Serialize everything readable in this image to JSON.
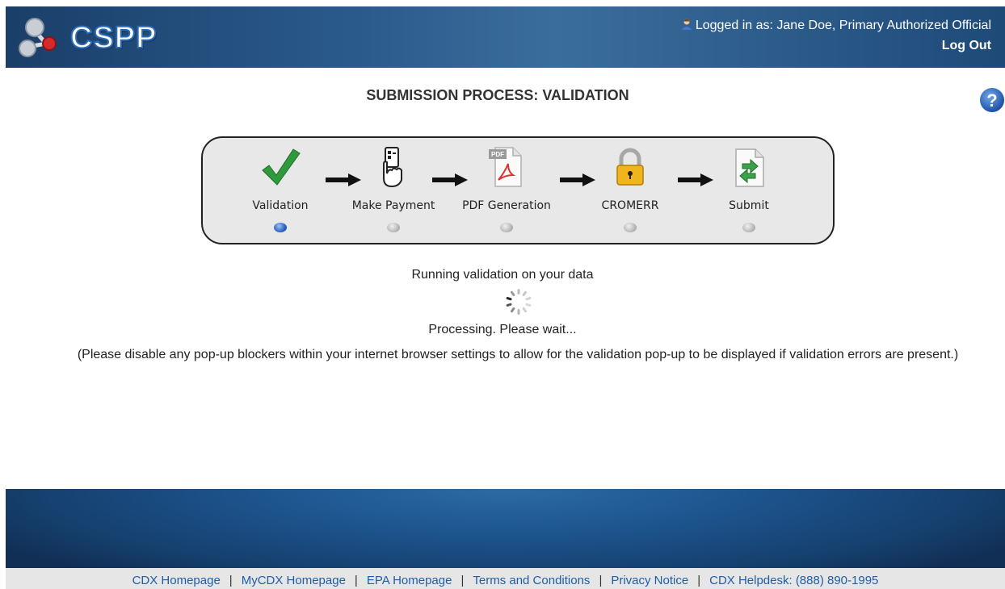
{
  "header": {
    "logo_text": "CSPP",
    "logged_in_prefix": "Logged in as:",
    "user_name": "Jane Doe, Primary Authorized Official",
    "logout_label": "Log Out"
  },
  "page": {
    "title": "SUBMISSION PROCESS: VALIDATION"
  },
  "steps": [
    {
      "label": "Validation",
      "active": true
    },
    {
      "label": "Make Payment",
      "active": false
    },
    {
      "label": "PDF Generation",
      "active": false
    },
    {
      "label": "CROMERR",
      "active": false
    },
    {
      "label": "Submit",
      "active": false
    }
  ],
  "status": {
    "running": "Running validation on your data",
    "processing": "Processing. Please wait...",
    "popup_notice": "(Please disable any pop-up blockers within your internet browser settings to allow for the validation pop-up to be displayed if validation errors are present.)"
  },
  "footer": {
    "links": [
      "CDX Homepage",
      "MyCDX Homepage",
      "EPA Homepage",
      "Terms and Conditions",
      "Privacy Notice",
      "CDX Helpdesk: (888) 890-1995"
    ]
  },
  "colors": {
    "header_blue": "#1a3f69",
    "link_blue": "#1d5ea8",
    "active_dot": "#2a62c4"
  }
}
